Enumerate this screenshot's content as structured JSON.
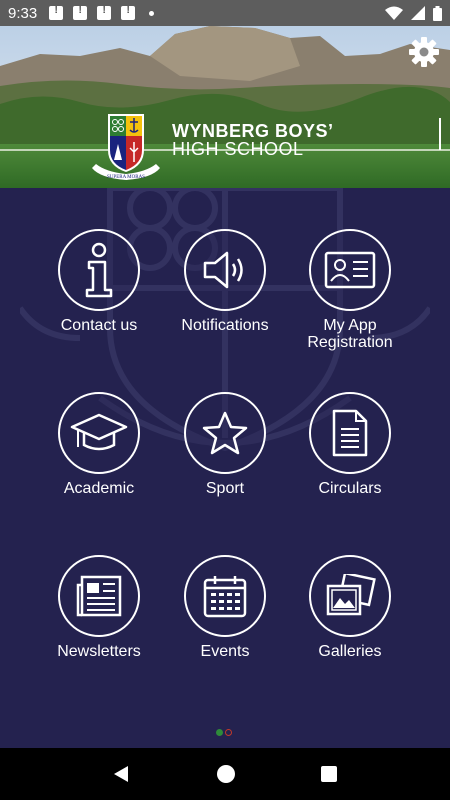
{
  "status_bar": {
    "time": "9:33",
    "notification_icons": [
      "alert-notification-icon",
      "alert-notification-icon",
      "alert-notification-icon",
      "alert-notification-icon",
      "dot-icon"
    ],
    "right_icons": [
      "wifi-icon",
      "signal-icon",
      "battery-icon"
    ]
  },
  "header": {
    "school_name_line1": "WYNBERG BOYS’",
    "school_name_line2": "HIGH SCHOOL",
    "crest_motto": "SUPERA MORAS",
    "settings_icon": "gear-icon"
  },
  "menu": [
    {
      "label": "Contact us",
      "icon": "info-icon"
    },
    {
      "label": "Notifications",
      "icon": "speaker-icon"
    },
    {
      "label": "My App\nRegistration",
      "label_line1": "My App",
      "label_line2": "Registration",
      "icon": "id-card-icon"
    },
    {
      "label": "Academic",
      "icon": "graduation-cap-icon"
    },
    {
      "label": "Sport",
      "icon": "star-icon"
    },
    {
      "label": "Circulars",
      "icon": "document-icon"
    },
    {
      "label": "Newsletters",
      "icon": "newspaper-icon"
    },
    {
      "label": "Events",
      "icon": "calendar-icon"
    },
    {
      "label": "Galleries",
      "icon": "photos-icon"
    }
  ],
  "pager": {
    "pages": 2,
    "current": 1,
    "active_color": "#2e8b3a",
    "inactive_color": "#c0392b"
  },
  "nav_bar": [
    "back-icon",
    "home-icon",
    "recents-icon"
  ],
  "colors": {
    "background": "#24224f",
    "status_bar": "#5d5d5d"
  }
}
